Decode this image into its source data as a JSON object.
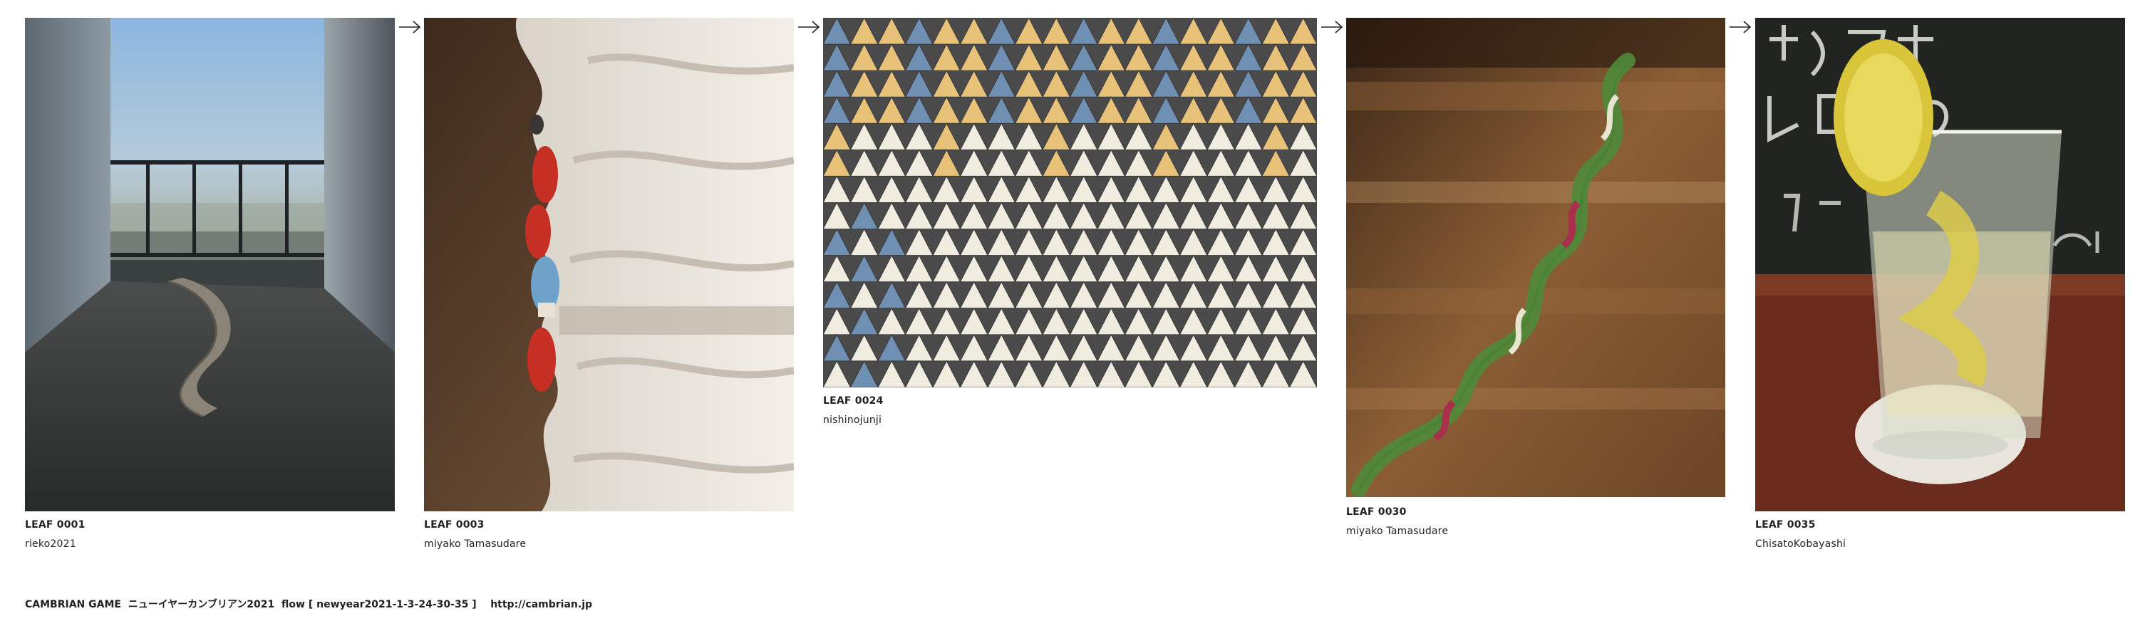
{
  "leaves": [
    {
      "id": "LEAF 0001",
      "author": "rieko2021",
      "photo_desc": "observation-deck-icon"
    },
    {
      "id": "LEAF 0003",
      "author": "miyako Tamasudare",
      "photo_desc": "gloves-curtain-icon"
    },
    {
      "id": "LEAF 0024",
      "author": "nishinojunji",
      "photo_desc": "triangle-tiles-icon"
    },
    {
      "id": "LEAF 0030",
      "author": "miyako Tamasudare",
      "photo_desc": "twisted-leaf-icon"
    },
    {
      "id": "LEAF 0035",
      "author": "ChisatoKobayashi",
      "photo_desc": "lemon-sour-icon"
    }
  ],
  "arrow_glyph": "→",
  "footer": {
    "brand": "CAMBRIAN GAME",
    "event": "ニューイヤーカンブリアン2021",
    "flow": "flow [ newyear2021-1-3-24-30-35 ]",
    "url": "http://cambrian.jp"
  },
  "colors": {
    "text": "#222222",
    "background": "#ffffff",
    "tile_dark": "#4a4a4a",
    "tile_light": "#f1ece0",
    "tile_yellow": "#e9c27a",
    "tile_blue": "#6f8fb3",
    "wood": "#6e4424",
    "chalkboard": "#222422"
  }
}
